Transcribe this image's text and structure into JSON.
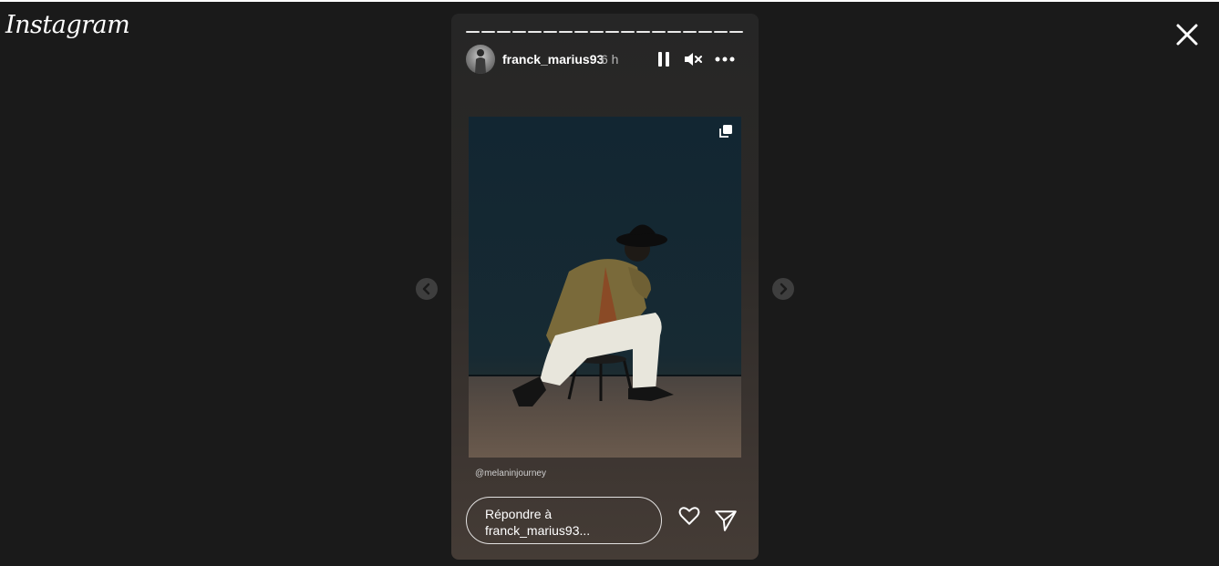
{
  "app": {
    "logo_text": "Instagram"
  },
  "story": {
    "progress_segments": 18,
    "user": {
      "username": "franck_marius93",
      "time_ago": "6 h"
    },
    "controls": {
      "pause_icon": "pause-icon",
      "mute_icon": "speaker-muted-icon",
      "more_icon": "more-horizontal-icon"
    },
    "media": {
      "mention": "@melaninjourney",
      "multi_icon": "multiple-posts-icon"
    },
    "reply": {
      "placeholder_line1": "Répondre à",
      "placeholder_line2": "franck_marius93..."
    }
  },
  "icons": {
    "close": "close-icon",
    "like": "heart-icon",
    "share": "send-icon",
    "prev": "chevron-left-icon",
    "next": "chevron-right-icon"
  },
  "colors": {
    "background": "#1a1a1a",
    "story_top": "#262626",
    "story_bottom": "#453c36"
  }
}
